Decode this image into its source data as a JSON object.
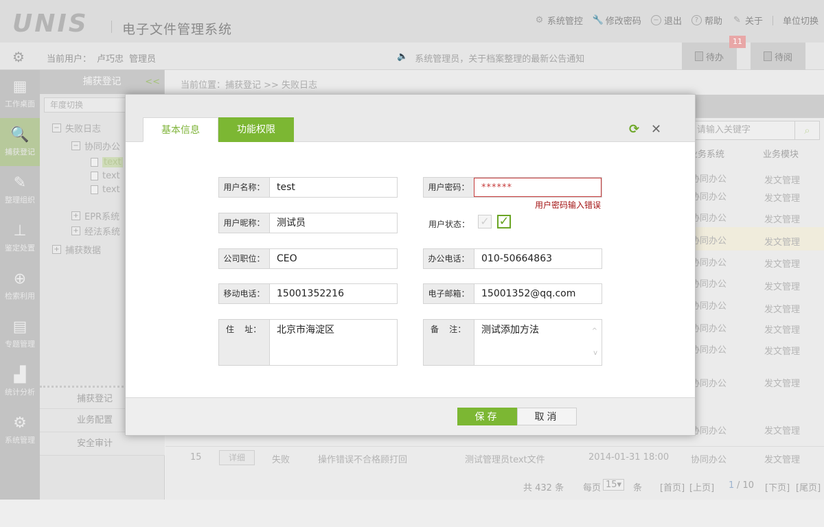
{
  "header": {
    "logo": "UNIS",
    "title": "电子文件管理系统",
    "menu": [
      {
        "icon": "gear-icon",
        "label": "系统管控"
      },
      {
        "icon": "wrench-icon",
        "label": "修改密码"
      },
      {
        "icon": "minus-circle-icon",
        "label": "退出"
      },
      {
        "icon": "question-icon",
        "label": "帮助"
      },
      {
        "icon": "tool-icon",
        "label": "关于"
      },
      {
        "icon": "",
        "label": "单位切换"
      }
    ]
  },
  "userbar": {
    "current_user_label": "当前用户：",
    "user_name": "卢巧忠",
    "role": "管理员",
    "notice": "系统管理员，关于档案整理的最新公告通知",
    "todo_label": "待办",
    "todo_count": "11",
    "toread_label": "待阅"
  },
  "iconbar": [
    {
      "icon": "desktop-icon",
      "label": "工作桌面"
    },
    {
      "icon": "capture-icon",
      "label": "捕获登记"
    },
    {
      "icon": "edit-icon",
      "label": "整理组织"
    },
    {
      "icon": "org-chart-icon",
      "label": "鉴定处置"
    },
    {
      "icon": "magnifier-icon",
      "label": "检索利用"
    },
    {
      "icon": "topic-icon",
      "label": "专题管理"
    },
    {
      "icon": "bar-chart-icon",
      "label": "统计分析"
    },
    {
      "icon": "cog-icon",
      "label": "系统管理"
    }
  ],
  "tree": {
    "title": "捕获登记",
    "collapse": "<<",
    "year_placeholder": "年度切换",
    "nodes": [
      "失败日志",
      "协同办公",
      "text",
      "text",
      "text",
      "EPR系统",
      "经法系统",
      "捕获数据"
    ],
    "bottom_menu": [
      "捕获登记",
      "业务配置",
      "安全审计"
    ]
  },
  "main": {
    "breadcrumb": "当前位置：捕获登记   >> 失败日志",
    "search_placeholder": "请输入关键字",
    "columns": [
      "业务系统",
      "业务模块"
    ],
    "rows": [
      [
        "协同办公",
        "发文管理"
      ],
      [
        "协同办公",
        "发文管理"
      ],
      [
        "协同办公",
        "发文管理"
      ],
      [
        "协同办公",
        "发文管理"
      ],
      [
        "协同办公",
        "发文管理"
      ],
      [
        "协同办公",
        "发文管理"
      ],
      [
        "协同办公",
        "发文管理"
      ],
      [
        "协同办公",
        "发文管理"
      ],
      [
        "协同办公",
        "发文管理"
      ],
      [
        "协同办公",
        "发文管理"
      ],
      [
        "协同办公",
        "发文管理"
      ]
    ],
    "last_row": {
      "no": "15",
      "detail": "详细",
      "status": "失败",
      "reason": "操作错误不合格顾打回",
      "file": "测试管理员text文件",
      "time": "2014-01-31 18:00",
      "system": "协同办公",
      "module": "发文管理"
    },
    "pager": {
      "total": "共 432 条",
      "per_page_label": "每页",
      "per_page": "15",
      "per_page_unit": "条",
      "first": "[首页]",
      "prev": "[上页]",
      "page_current": "1",
      "page_total": "/ 10",
      "next": "[下页]",
      "last": "[尾页]"
    }
  },
  "modal": {
    "tab_basic": "基本信息",
    "tab_perm": "功能权限",
    "fields": {
      "username_label": "用户名称：",
      "username": "test",
      "password_label": "用户密码：",
      "password": "******",
      "password_error": "用户密码输入错误",
      "nickname_label": "用户昵称：",
      "nickname": "测试员",
      "status_label": "用户状态：",
      "position_label": "公司职位：",
      "position": "CEO",
      "office_phone_label": "办公电话：",
      "office_phone": "010-50664863",
      "mobile_label": "移动电话：",
      "mobile": "15001352216",
      "email_label": "电子邮箱：",
      "email": "15001352@qq.com",
      "address_label": "住    址：",
      "address": "北京市海淀区",
      "remark_label": "备    注：",
      "remark": "测试添加方法"
    },
    "save": "保存",
    "cancel": "取消"
  },
  "colors": {
    "accent_green": "#7cb733",
    "error_red": "#c63a3a"
  }
}
